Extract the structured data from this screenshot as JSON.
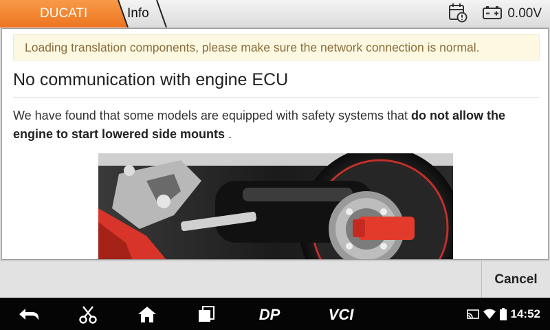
{
  "header": {
    "brand_tab": "DUCATI",
    "info_tab": "Info",
    "voltage": "0.00V",
    "icons": [
      "calendar-alert-icon",
      "battery-icon"
    ],
    "accent": "#f07f26"
  },
  "notice": {
    "text": "Loading translation components, please make sure the network connection is normal."
  },
  "article": {
    "title": "No communication with engine ECU",
    "para_normal": "We have found that some models are equipped with safety systems that ",
    "para_bold": "do not allow the engine to start lowered side mounts",
    "para_end": " ."
  },
  "footer": {
    "cancel_label": "Cancel"
  },
  "navbar": {
    "icons": [
      "back-icon",
      "scissors-icon",
      "home-icon",
      "recent-apps-icon",
      "dp-logo-icon",
      "vci-logo-icon"
    ],
    "dp_label": "DP",
    "vci_label": "VCI",
    "status_icons": [
      "cast-icon",
      "wifi-icon",
      "battery-status-icon"
    ],
    "time": "14:52"
  }
}
